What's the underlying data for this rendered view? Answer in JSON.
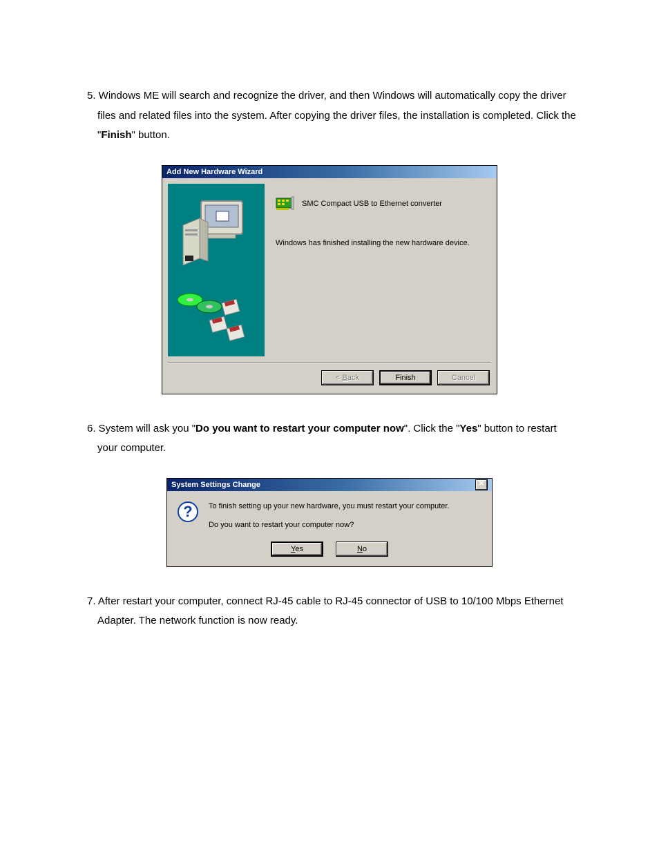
{
  "step5": {
    "num": "5.",
    "text_a": " Windows ME will search and recognize the driver, and then Windows will automatically copy the driver files and related files into the system. After copying the driver files, the installation is completed.   Click the \"",
    "bold": "Finish",
    "text_b": "\" button."
  },
  "wizard": {
    "title": "Add New Hardware Wizard",
    "device": "SMC Compact USB to Ethernet converter",
    "message": "Windows has finished installing the new hardware device.",
    "back": "< Back",
    "finish": "Finish",
    "cancel": "Cancel"
  },
  "step6": {
    "num": "6.",
    "text_a": " System will ask you \"",
    "bold1": "Do you want to restart your computer now",
    "text_b": "\". Click the \"",
    "bold2": "Yes",
    "text_c": "\" button to restart your computer."
  },
  "restart": {
    "title": "System Settings Change",
    "line1": "To finish setting up your new hardware, you must restart your computer.",
    "line2": "Do you want to restart your computer now?",
    "yes": "Yes",
    "no": "No",
    "close": "✕"
  },
  "step7": {
    "num": "7.",
    "text": " After restart your computer, connect RJ-45 cable to RJ-45 connector of USB to 10/100 Mbps Ethernet Adapter.   The network function is now ready."
  }
}
